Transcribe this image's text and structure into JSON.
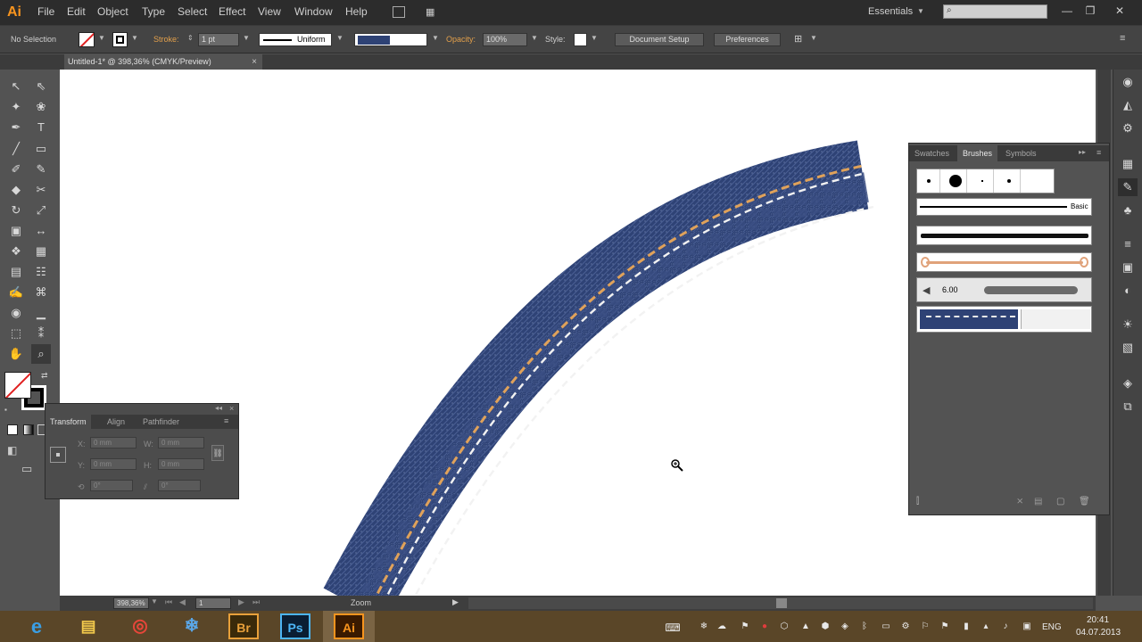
{
  "app": {
    "logo": "Ai"
  },
  "menu": [
    "File",
    "Edit",
    "Object",
    "Type",
    "Select",
    "Effect",
    "View",
    "Window",
    "Help"
  ],
  "workspace": "Essentials",
  "window_controls": {
    "minimize": "—",
    "restore": "❐",
    "close": "✕"
  },
  "control": {
    "selection": "No Selection",
    "stroke_label": "Stroke:",
    "stroke_weight": "1 pt",
    "profile": "Uniform",
    "opacity_label": "Opacity:",
    "opacity": "100%",
    "style_label": "Style:",
    "document_setup": "Document Setup",
    "preferences": "Preferences"
  },
  "document": {
    "tab_title": "Untitled-1* @ 398,36% (CMYK/Preview)",
    "close": "×"
  },
  "tools": [
    "↖",
    "⇖",
    "✦",
    "❀",
    "✒",
    "T",
    "╱",
    "▭",
    "✐",
    "✎",
    "◆",
    "✂",
    "↻",
    "⤢",
    "▣",
    "↔",
    "❖",
    "▦",
    "▤",
    "☷",
    "✍",
    "⌘",
    "◉",
    "▁",
    "⬚",
    "⁑",
    "✋",
    "⌕"
  ],
  "transform": {
    "tabs": [
      "Transform",
      "Align",
      "Pathfinder"
    ],
    "x_label": "X:",
    "y_label": "Y:",
    "w_label": "W:",
    "h_label": "H:",
    "x": "0 mm",
    "y": "0 mm",
    "w": "0 mm",
    "h": "0 mm",
    "rotate": "0°",
    "shear": "0°"
  },
  "brushes": {
    "tabs": [
      "Swatches",
      "Brushes",
      "Symbols"
    ],
    "basic_label": "Basic",
    "bristle_size": "6.00"
  },
  "status": {
    "zoom": "398,36%",
    "page": "1",
    "tool": "Zoom"
  },
  "taskbar": {
    "apps": [
      "e",
      "▤",
      "◎",
      "❄",
      "Br",
      "Ps",
      "Ai"
    ],
    "lang": "ENG",
    "time": "20:41",
    "date": "04.07.2013"
  },
  "colors": {
    "ui_dark": "#2c2c2c",
    "ui_mid": "#535353",
    "accent_orange": "#f7941e",
    "denim": "#2e4275",
    "stitch_orange": "#e0a25a",
    "stitch_white": "#f2f2f2"
  }
}
